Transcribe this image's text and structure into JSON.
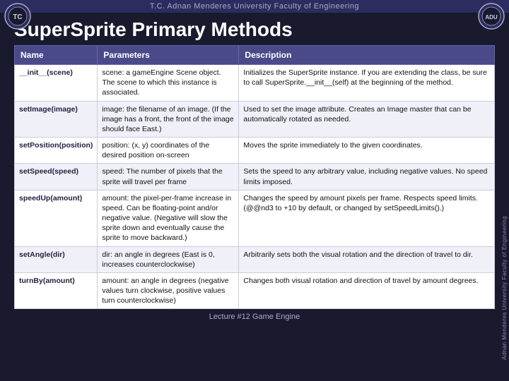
{
  "header": {
    "university": "T.C.  Adnan Menderes University  Faculty of Engineering"
  },
  "title": "SuperSprite Primary Methods",
  "side_text": "Adnan Menderes University  Faculty of Engineering",
  "footer": "Lecture #12 Game Engine",
  "table": {
    "columns": [
      "Name",
      "Parameters",
      "Description"
    ],
    "rows": [
      {
        "name": "__init__(scene)",
        "parameters": "scene: a gameEngine Scene object. The scene to which this instance is associated.",
        "description": "Initializes the SuperSprite instance. If you are extending the class, be sure to call SuperSprite.__init__(self) at the beginning of the method."
      },
      {
        "name": "setImage(image)",
        "parameters": "image: the filename of an image. (If the image has a front, the front of the image should face East.)",
        "description": "Used to set the image attribute. Creates an Image master that can be automatically rotated as needed."
      },
      {
        "name": "setPosition(position)",
        "parameters": "position: (x, y) coordinates of the desired position on-screen",
        "description": "Moves the sprite immediately to the given coordinates."
      },
      {
        "name": "setSpeed(speed)",
        "parameters": "speed: The number of pixels that the sprite will travel per frame",
        "description": "Sets the speed to any arbitrary value, including negative values. No speed limits imposed."
      },
      {
        "name": "speedUp(amount)",
        "parameters": "amount: the pixel-per-frame increase in speed. Can be floating-point and/or negative value. (Negative will slow the sprite down and eventually cause the sprite to move backward.)",
        "description": "Changes the speed by amount pixels per frame. Respects speed limits. (@@nd3 to +10 by default, or changed by setSpeedLimits().)"
      },
      {
        "name": "setAngle(dir)",
        "parameters": "dir: an angle in degrees (East is 0, increases counterclockwise)",
        "description": "Arbitrarily sets both the visual rotation and the direction of travel to dir."
      },
      {
        "name": "turnBy(amount)",
        "parameters": "amount: an angle in degrees (negative values turn clockwise, positive values turn counterclockwise)",
        "description": "Changes both visual rotation and direction of travel by amount degrees."
      }
    ]
  }
}
